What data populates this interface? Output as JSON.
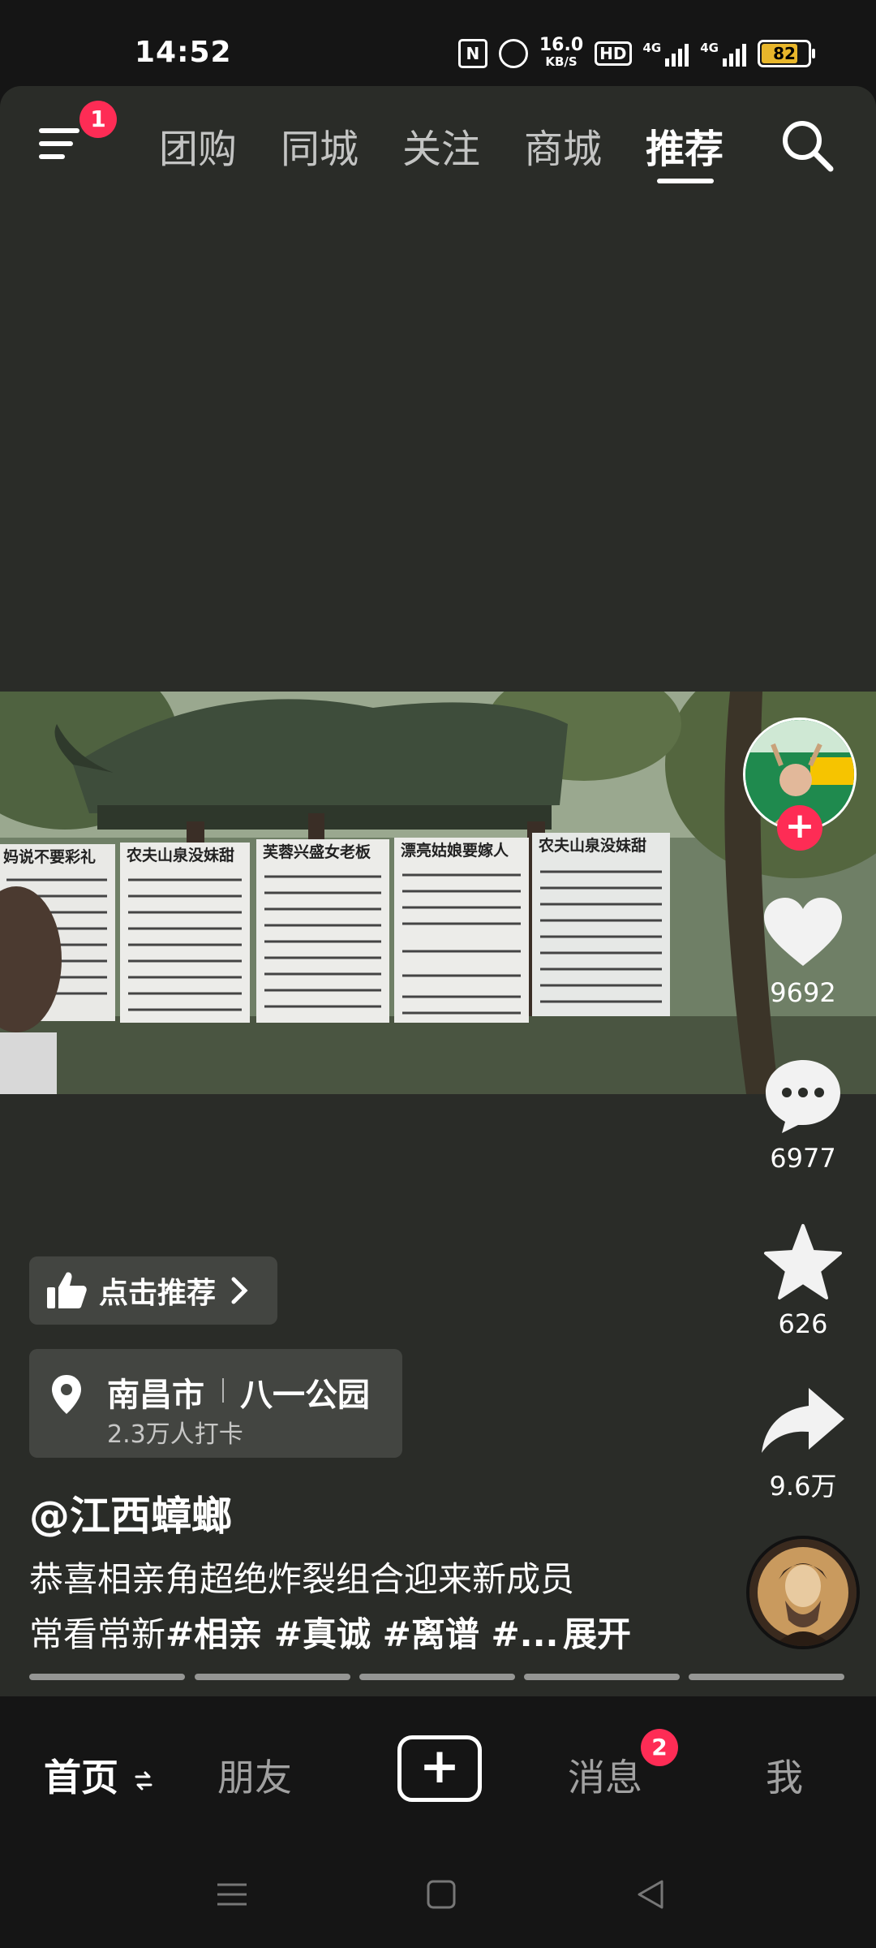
{
  "status_bar": {
    "time": "14:52",
    "nfc": "N",
    "speed_value": "16.0",
    "speed_unit": "KB/S",
    "hd_label": "HD",
    "net1": "4G",
    "net2": "4G",
    "battery": "82"
  },
  "top_nav": {
    "menu_badge": "1",
    "tabs": [
      "团购",
      "同城",
      "关注",
      "商城",
      "推荐"
    ],
    "active_tab": "推荐"
  },
  "actions": {
    "likes": "9692",
    "comments": "6977",
    "favorites": "626",
    "shares": "9.6万"
  },
  "recommend_chip": {
    "label": "点击推荐"
  },
  "location": {
    "city": "南昌市",
    "place": "八一公园",
    "checkins": "2.3万人打卡"
  },
  "post": {
    "author": "@江西蟑螂",
    "caption_line1": "恭喜相亲角超绝炸裂组合迎来新成员",
    "caption_line2_prefix": "常看常新",
    "hashtags": "#相亲 #真诚 #离谱 #...",
    "expand": "展开"
  },
  "video_signs": [
    "妈说不要彩礼",
    "农夫山泉没妹甜",
    "芙蓉兴盛女老板",
    "漂亮姑娘要嫁人",
    "农夫山泉没妹甜"
  ],
  "bottom_tabs": {
    "home": "首页",
    "friends": "朋友",
    "messages": "消息",
    "messages_badge": "2",
    "me": "我"
  },
  "colors": {
    "accent_red": "#fe2c55",
    "card_bg": "#2a2c28",
    "battery": "#e8b62b"
  }
}
